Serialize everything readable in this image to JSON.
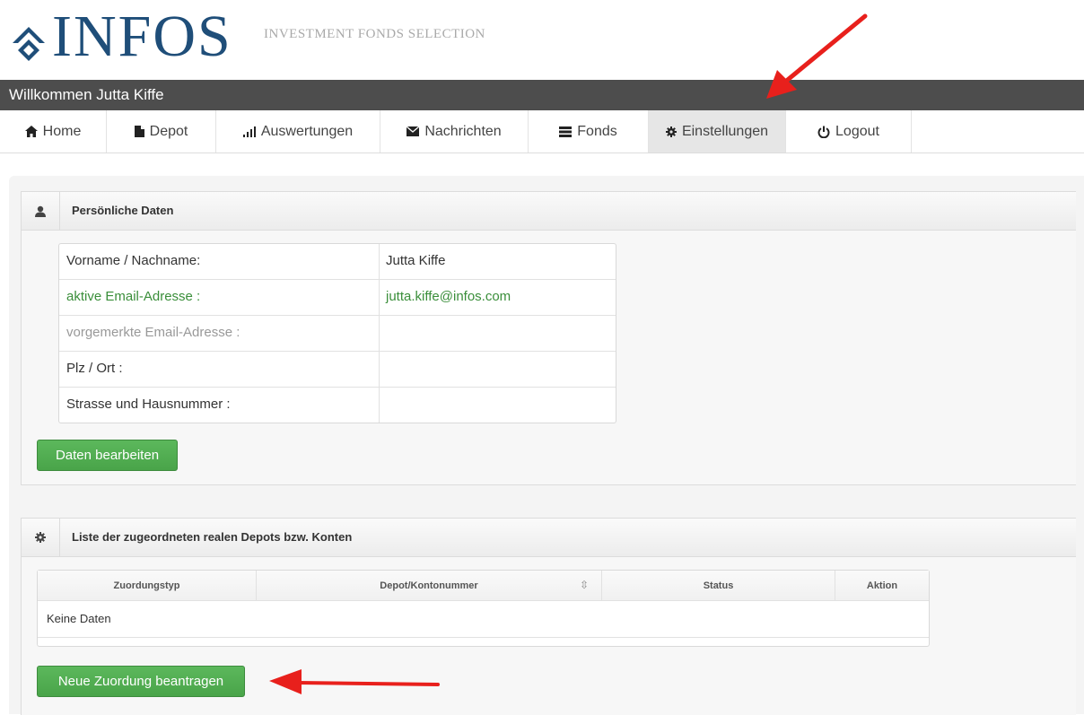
{
  "header": {
    "logo_text": "INFOS",
    "logo_subtitle": "INVESTMENT FONDS SELECTION",
    "welcome": "Willkommen Jutta Kiffe",
    "brand_color": "#1f4e79"
  },
  "nav": {
    "items": [
      {
        "label": "Home",
        "icon": "home-icon"
      },
      {
        "label": "Depot",
        "icon": "file-icon"
      },
      {
        "label": "Auswertungen",
        "icon": "signal-icon"
      },
      {
        "label": "Nachrichten",
        "icon": "envelope-icon"
      },
      {
        "label": "Fonds",
        "icon": "list-icon"
      },
      {
        "label": "Einstellungen",
        "icon": "gear-icon",
        "active": true
      },
      {
        "label": "Logout",
        "icon": "power-icon"
      }
    ]
  },
  "personal": {
    "title": "Persönliche Daten",
    "rows": [
      {
        "label": "Vorname / Nachname:",
        "value": "Jutta Kiffe"
      },
      {
        "label": "aktive Email-Adresse :",
        "value": "jutta.kiffe@infos.com"
      },
      {
        "label": "vorgemerkte Email-Adresse :",
        "value": ""
      },
      {
        "label": "Plz / Ort :",
        "value": ""
      },
      {
        "label": "Strasse und Hausnummer :",
        "value": ""
      }
    ],
    "edit_button": "Daten bearbeiten"
  },
  "depots": {
    "title": "Liste der zugeordneten realen Depots bzw. Konten",
    "columns": [
      "Zuordungstyp",
      "Depot/Kontonummer",
      "Status",
      "Aktion"
    ],
    "empty_text": "Keine Daten",
    "new_button": "Neue Zuordung beantragen"
  },
  "colors": {
    "accent_green": "#5cb85c",
    "annotation_red": "#e8201c",
    "welcome_bar": "#4d4d4d"
  }
}
